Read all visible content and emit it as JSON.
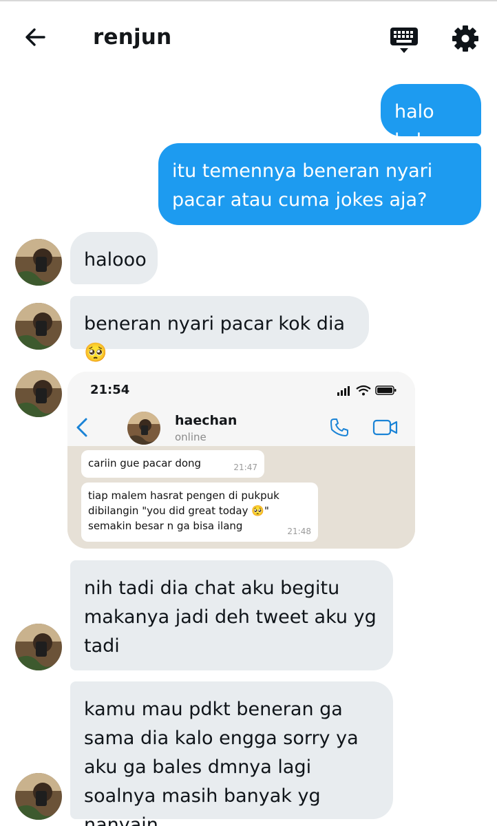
{
  "header": {
    "title": "renjun",
    "back_icon": "arrow-left-icon",
    "keyboard_icon": "keyboard-icon",
    "settings_icon": "gear-icon"
  },
  "messages": [
    {
      "side": "out",
      "text": "halo kak"
    },
    {
      "side": "out",
      "text": "itu temennya beneran nyari pacar atau cuma jokes aja?"
    },
    {
      "side": "in",
      "text": "halooo"
    },
    {
      "side": "in",
      "text": "beneran nyari pacar kok dia 🥺"
    },
    {
      "side": "in",
      "type": "image"
    },
    {
      "side": "in",
      "text": "nih tadi dia chat aku begitu makanya jadi deh tweet aku yg tadi"
    },
    {
      "side": "in",
      "text": "kamu mau pdkt beneran ga sama dia kalo engga sorry ya aku ga bales dmnya lagi soalnya masih banyak yg nanyain"
    }
  ],
  "screenshot": {
    "time": "21:54",
    "contact_name": "haechan",
    "contact_status": "online",
    "messages": [
      {
        "text": "cariin gue pacar dong",
        "time": "21:47"
      },
      {
        "text": "tiap malem hasrat pengen di pukpuk dibilangin \"you did great today 🥺\" semakin besar n ga bisa ilang",
        "time": "21:48"
      }
    ]
  },
  "colors": {
    "outgoing_bubble": "#1d9bf0",
    "incoming_bubble": "#e8ecef",
    "whatsapp_accent": "#1a83d6"
  }
}
